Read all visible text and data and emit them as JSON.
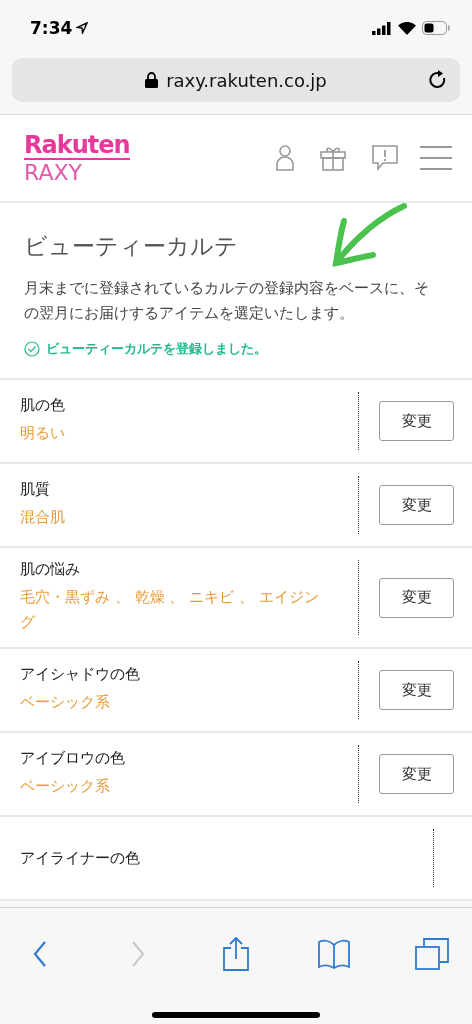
{
  "status_bar": {
    "time": "7:34"
  },
  "url_bar": {
    "url": "raxy.rakuten.co.jp"
  },
  "header": {
    "logo_top": "Rakuten",
    "logo_bottom": "RAXY"
  },
  "intro": {
    "title": "ビューティーカルテ",
    "description": "月末までに登録されているカルテの登録内容をベースに、その翌月にお届けするアイテムを選定いたします。",
    "notice": "ビューティーカルテを登録しました。"
  },
  "items": [
    {
      "label": "肌の色",
      "value": "明るい",
      "button": "変更"
    },
    {
      "label": "肌質",
      "value": "混合肌",
      "button": "変更"
    },
    {
      "label": "肌の悩み",
      "value": "毛穴・黒ずみ 、 乾燥 、 ニキビ 、 エイジング",
      "button": "変更"
    },
    {
      "label": "アイシャドウの色",
      "value": "ベーシック系",
      "button": "変更"
    },
    {
      "label": "アイブロウの色",
      "value": "ベーシック系",
      "button": "変更"
    },
    {
      "label": "アイライナーの色"
    }
  ],
  "toolbar": {
    "buttons": [
      {
        "kind": "back",
        "disabled": false
      },
      {
        "kind": "forward",
        "disabled": true
      },
      {
        "kind": "share",
        "disabled": false
      },
      {
        "kind": "bookmarks",
        "disabled": false
      },
      {
        "kind": "tabs",
        "disabled": false
      }
    ]
  }
}
